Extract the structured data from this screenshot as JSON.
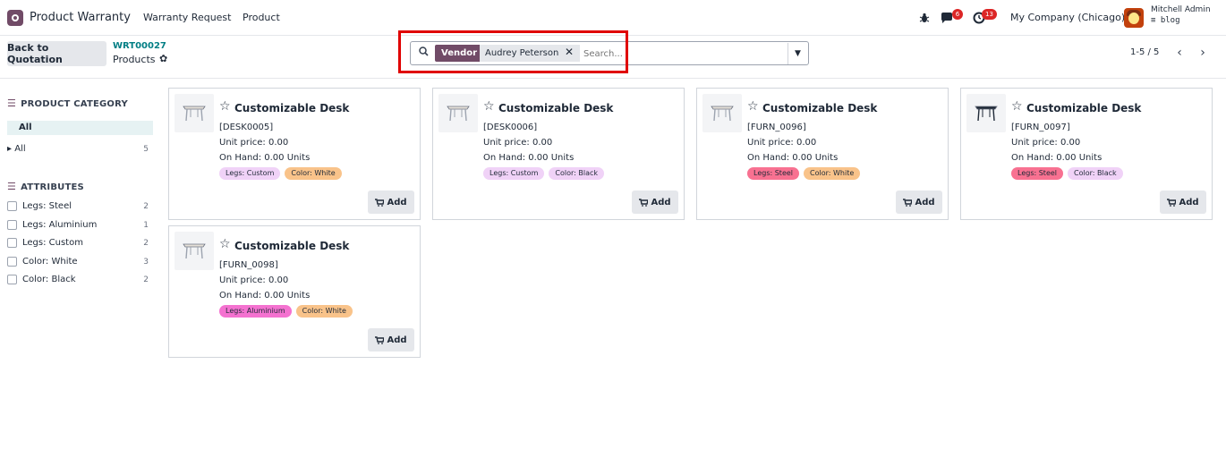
{
  "navbar": {
    "app_title": "Product Warranty",
    "menu": [
      "Warranty Request",
      "Product"
    ],
    "chat_badge": "6",
    "activity_badge": "13",
    "company": "My Company (Chicago)",
    "user_name": "Mitchell Admin",
    "user_db": "blog"
  },
  "control": {
    "back_label": "Back to Quotation",
    "breadcrumb_ref": "WRT00027",
    "breadcrumb_current": "Products",
    "search_facet_label": "Vendor",
    "search_facet_value": "Audrey Peterson",
    "search_placeholder": "Search...",
    "pager": "1-5 / 5"
  },
  "sidebar": {
    "category_title": "PRODUCT CATEGORY",
    "category_active": "All",
    "categories": [
      {
        "label": "All",
        "count": "5"
      }
    ],
    "attributes_title": "ATTRIBUTES",
    "attributes": [
      {
        "label": "Legs: Steel",
        "count": "2"
      },
      {
        "label": "Legs: Aluminium",
        "count": "1"
      },
      {
        "label": "Legs: Custom",
        "count": "2"
      },
      {
        "label": "Color: White",
        "count": "3"
      },
      {
        "label": "Color: Black",
        "count": "2"
      }
    ]
  },
  "cards": [
    {
      "name": "Customizable Desk",
      "code": "[DESK0005]",
      "price": "Unit price: 0.00",
      "onhand": "On Hand: 0.00 Units",
      "tags": [
        {
          "label": "Legs: Custom",
          "color": "#f0d2f7"
        },
        {
          "label": "Color: White",
          "color": "#f9c38a"
        }
      ],
      "add": "Add",
      "legs_color": "#9ca3af"
    },
    {
      "name": "Customizable Desk",
      "code": "[DESK0006]",
      "price": "Unit price: 0.00",
      "onhand": "On Hand: 0.00 Units",
      "tags": [
        {
          "label": "Legs: Custom",
          "color": "#f0d2f7"
        },
        {
          "label": "Color: Black",
          "color": "#f0d2f7"
        }
      ],
      "add": "Add",
      "legs_color": "#9ca3af"
    },
    {
      "name": "Customizable Desk",
      "code": "[FURN_0096]",
      "price": "Unit price: 0.00",
      "onhand": "On Hand: 0.00 Units",
      "tags": [
        {
          "label": "Legs: Steel",
          "color": "#f87191"
        },
        {
          "label": "Color: White",
          "color": "#f9c38a"
        }
      ],
      "add": "Add",
      "legs_color": "#9ca3af"
    },
    {
      "name": "Customizable Desk",
      "code": "[FURN_0097]",
      "price": "Unit price: 0.00",
      "onhand": "On Hand: 0.00 Units",
      "tags": [
        {
          "label": "Legs: Steel",
          "color": "#f87191"
        },
        {
          "label": "Color: Black",
          "color": "#f0d2f7"
        }
      ],
      "add": "Add",
      "legs_color": "#1f2937"
    },
    {
      "name": "Customizable Desk",
      "code": "[FURN_0098]",
      "price": "Unit price: 0.00",
      "onhand": "On Hand: 0.00 Units",
      "tags": [
        {
          "label": "Legs: Aluminium",
          "color": "#f472d0"
        },
        {
          "label": "Color: White",
          "color": "#f9c38a"
        }
      ],
      "add": "Add",
      "legs_color": "#9ca3af"
    }
  ]
}
